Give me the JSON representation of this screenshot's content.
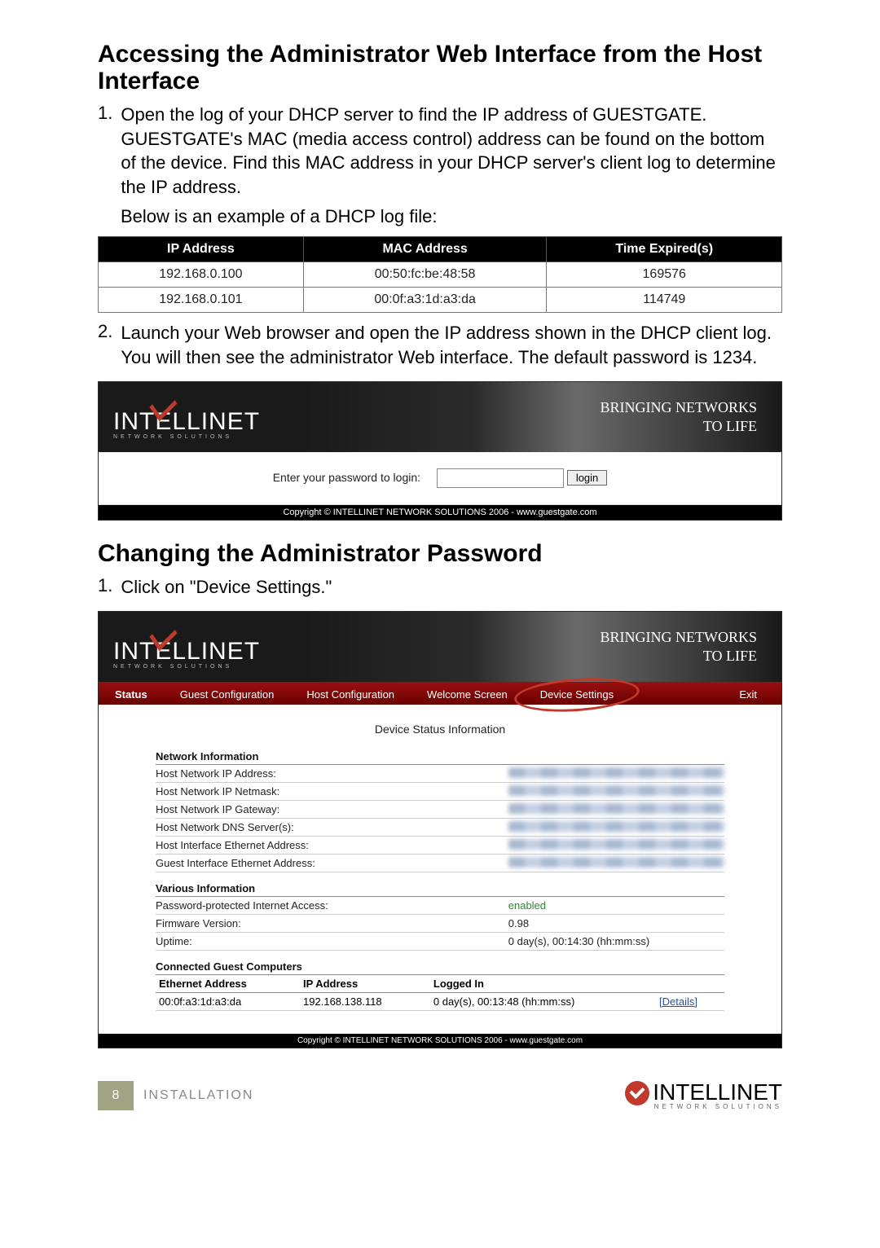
{
  "headings": {
    "h1": "Accessing the Administrator Web Interface from the Host Interface",
    "h2": "Changing the Administrator Password"
  },
  "paragraphs": {
    "p1_num": "1.",
    "p1": "Open the log of your DHCP server to find the IP address of GUESTGATE. GUESTGATE's MAC (media access control) address can be found on the bottom of the device. Find this MAC address in your DHCP server's client log to determine the IP address.",
    "p1b": "Below is an example of a DHCP log file:",
    "p2_num": "2.",
    "p2": "Launch your Web browser and open the IP address shown in the DHCP client log. You will then see the administrator Web interface. The default password is 1234.",
    "p3_num": "1.",
    "p3": "Click on \"Device Settings.\""
  },
  "dhcp_table": {
    "headers": [
      "IP Address",
      "MAC Address",
      "Time Expired(s)"
    ],
    "rows": [
      [
        "192.168.0.100",
        "00:50:fc:be:48:58",
        "169576"
      ],
      [
        "192.168.0.101",
        "00:0f:a3:1d:a3:da",
        "114749"
      ]
    ]
  },
  "brand": {
    "name": "INTELLINET",
    "sub": "NETWORK SOLUTIONS",
    "tagline_a": "BRINGING NETWORKS",
    "tagline_b": "TO LIFE"
  },
  "login": {
    "label": "Enter your password to login:",
    "button": "login"
  },
  "copyright": "Copyright © INTELLINET NETWORK SOLUTIONS 2006 - www.guestgate.com",
  "tabs": {
    "status": "Status",
    "guest": "Guest Configuration",
    "host": "Host Configuration",
    "welcome": "Welcome Screen",
    "device": "Device Settings",
    "exit": "Exit"
  },
  "status_page": {
    "title": "Device Status Information",
    "grp1": "Network Information",
    "rows1": [
      "Host Network IP Address:",
      "Host Network IP Netmask:",
      "Host Network IP Gateway:",
      "Host Network DNS Server(s):",
      "Host Interface Ethernet Address:",
      "Guest Interface Ethernet Address:"
    ],
    "grp2": "Various Information",
    "rows2": [
      {
        "k": "Password-protected Internet Access:",
        "v": "enabled"
      },
      {
        "k": "Firmware Version:",
        "v": "0.98"
      },
      {
        "k": "Uptime:",
        "v": "0 day(s), 00:14:30 (hh:mm:ss)"
      }
    ],
    "grp3": "Connected Guest Computers",
    "guest_headers": [
      "Ethernet Address",
      "IP Address",
      "Logged In",
      ""
    ],
    "guest_row": [
      "00:0f:a3:1d:a3:da",
      "192.168.138.118",
      "0 day(s), 00:13:48 (hh:mm:ss)",
      "[Details]"
    ]
  },
  "footer": {
    "page": "8",
    "section": "INSTALLATION",
    "logo": "INTELLINET",
    "logo_sub": "NETWORK SOLUTIONS"
  }
}
